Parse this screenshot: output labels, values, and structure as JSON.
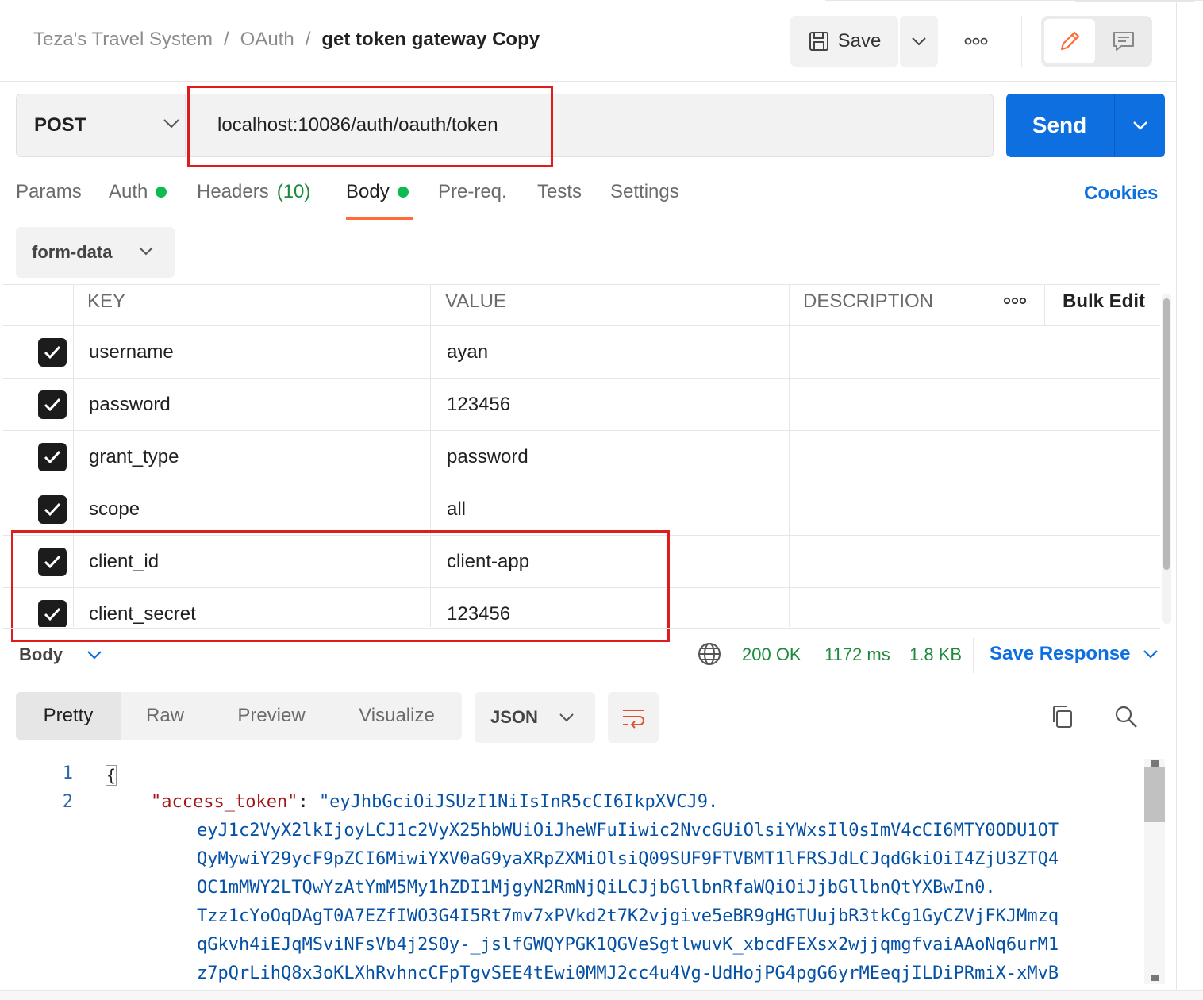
{
  "header": {
    "breadcrumb": [
      "Teza's Travel System",
      "OAuth"
    ],
    "separator": "/",
    "title": "get token gateway Copy",
    "save_label": "Save",
    "more_label": "ooo"
  },
  "request": {
    "method": "POST",
    "url": "localhost:10086/auth/oauth/token",
    "send_label": "Send"
  },
  "tabs": {
    "params": "Params",
    "auth": "Auth",
    "headers": "Headers",
    "headers_count": "(10)",
    "body": "Body",
    "prereq": "Pre-req.",
    "tests": "Tests",
    "settings": "Settings",
    "cookies": "Cookies"
  },
  "body_mode": "form-data",
  "params_table": {
    "col_key": "KEY",
    "col_value": "VALUE",
    "col_description": "DESCRIPTION",
    "more_label": "ooo",
    "bulk_edit": "Bulk Edit",
    "rows": [
      {
        "key": "username",
        "value": "ayan",
        "checked": true
      },
      {
        "key": "password",
        "value": "123456",
        "checked": true
      },
      {
        "key": "grant_type",
        "value": "password",
        "checked": true
      },
      {
        "key": "scope",
        "value": "all",
        "checked": true
      },
      {
        "key": "client_id",
        "value": "client-app",
        "checked": true
      },
      {
        "key": "client_secret",
        "value": "123456",
        "checked": true
      }
    ]
  },
  "response": {
    "title": "Body",
    "status": "200 OK",
    "time": "1172 ms",
    "size": "1.8 KB",
    "save_response": "Save Response",
    "view_tabs": [
      "Pretty",
      "Raw",
      "Preview",
      "Visualize"
    ],
    "format": "JSON"
  },
  "code": {
    "line_numbers": [
      "1",
      "2"
    ],
    "open_brace": "{",
    "key": "\"access_token\"",
    "colon": ": ",
    "value_lines": [
      "\"eyJhbGciOiJSUzI1NiIsInR5cCI6IkpXVCJ9.",
      "eyJ1c2VyX2lkIjoyLCJ1c2VyX25hbWUiOiJheWFuIiwic2NvcGUiOlsiYWxsIl0sImV4cCI6MTY0ODU1OT",
      "QyMywiY29ycF9pZCI6MiwiYXV0aG9yaXRpZXMiOlsiQ09SUF9FTVBMT1lFRSJdLCJqdGkiOiI4ZjU3ZTQ4",
      "OC1mMWY2LTQwYzAtYmM5My1hZDI1MjgyN2RmNjQiLCJjbGllbnRfaWQiOiJjbGllbnQtYXBwIn0.",
      "Tzz1cYoOqDAgT0A7EZfIWO3G4I5Rt7mv7xPVkd2t7K2vjgive5eBR9gHGTUujbR3tkCg1GyCZVjFKJMmzq",
      "qGkvh4iEJqMSviNFsVb4j2S0y-_jslfGWQYPGK1QGVeSgtlwuvK_xbcdFEXsx2wjjqmgfvaiAAoNq6urM1",
      "z7pQrLihQ8x3oKLXhRvhncCFpTgvSEE4tEwi0MMJ2cc4u4Vg-UdHojPG4pgG6yrMEeqjILDiPRmiX-xMvB"
    ]
  }
}
